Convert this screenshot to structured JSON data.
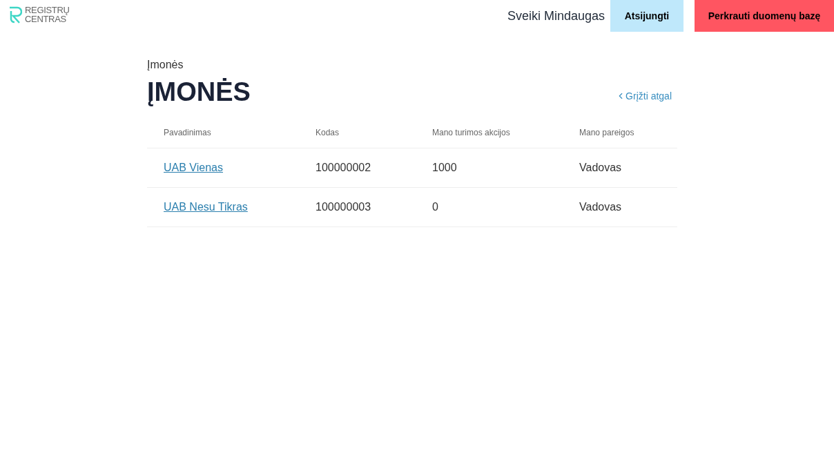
{
  "header": {
    "logo": [
      "REGISTRŲ",
      "CENTRAS"
    ],
    "greeting": "Sveiki Mindaugas",
    "buttons": [
      {
        "label": "Atsijungti",
        "kind": "secondary"
      },
      {
        "label": "Perkrauti duomenų bazę",
        "kind": "danger"
      }
    ]
  },
  "breadcrumb": "Įmonės",
  "title": "ĮMONĖS",
  "back_link": "Grįžti atgal",
  "table": {
    "columns": [
      "Pavadinimas",
      "Kodas",
      "Mano turimos akcijos",
      "Mano pareigos"
    ],
    "rows": [
      {
        "name": "UAB Vienas",
        "code": "100000002",
        "shares": "1000",
        "role": "Vadovas"
      },
      {
        "name": "UAB Nesu Tikras",
        "code": "100000003",
        "shares": "0",
        "role": "Vadovas"
      }
    ]
  }
}
